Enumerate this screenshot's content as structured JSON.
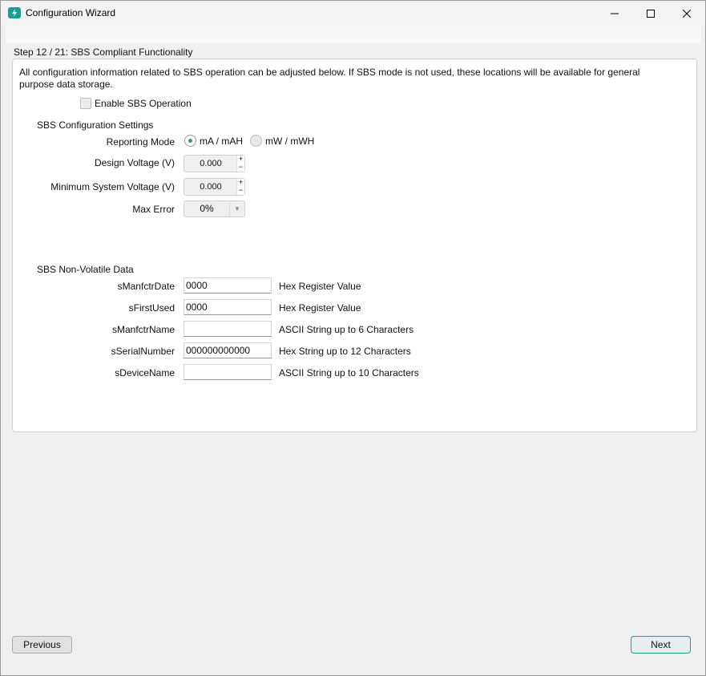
{
  "window": {
    "title": "Configuration Wizard",
    "icon": "battery-bolt-icon"
  },
  "step": {
    "label": "Step 12 / 21: SBS Compliant Functionality"
  },
  "description": "All configuration information related to SBS operation can be adjusted below. If SBS mode is not used, these locations will be available for general purpose data storage.",
  "enable_sbs": {
    "label": "Enable SBS Operation",
    "checked": false
  },
  "sbs_config": {
    "title": "SBS Configuration Settings",
    "reporting_mode": {
      "label": "Reporting Mode",
      "options": [
        "mA / mAH",
        "mW / mWH"
      ],
      "selected": "mA / mAH"
    },
    "design_voltage": {
      "label": "Design Voltage (V)",
      "value": "0.000"
    },
    "min_system_voltage": {
      "label": "Minimum System Voltage (V)",
      "value": "0.000"
    },
    "max_error": {
      "label": "Max Error",
      "value": "0%"
    }
  },
  "nv_data": {
    "title": "SBS Non-Volatile Data",
    "rows": [
      {
        "label": "sManfctrDate",
        "value": "0000",
        "hint": "Hex Register Value"
      },
      {
        "label": "sFirstUsed",
        "value": "0000",
        "hint": "Hex Register Value"
      },
      {
        "label": "sManfctrName",
        "value": "",
        "hint": "ASCII String up to 6 Characters"
      },
      {
        "label": "sSerialNumber",
        "value": "000000000000",
        "hint": "Hex String up to 12 Characters"
      },
      {
        "label": "sDeviceName",
        "value": "",
        "hint": "ASCII String up to 10 Characters"
      }
    ]
  },
  "buttons": {
    "previous": "Previous",
    "next": "Next"
  },
  "colors": {
    "accent": "#1a9e8f"
  }
}
